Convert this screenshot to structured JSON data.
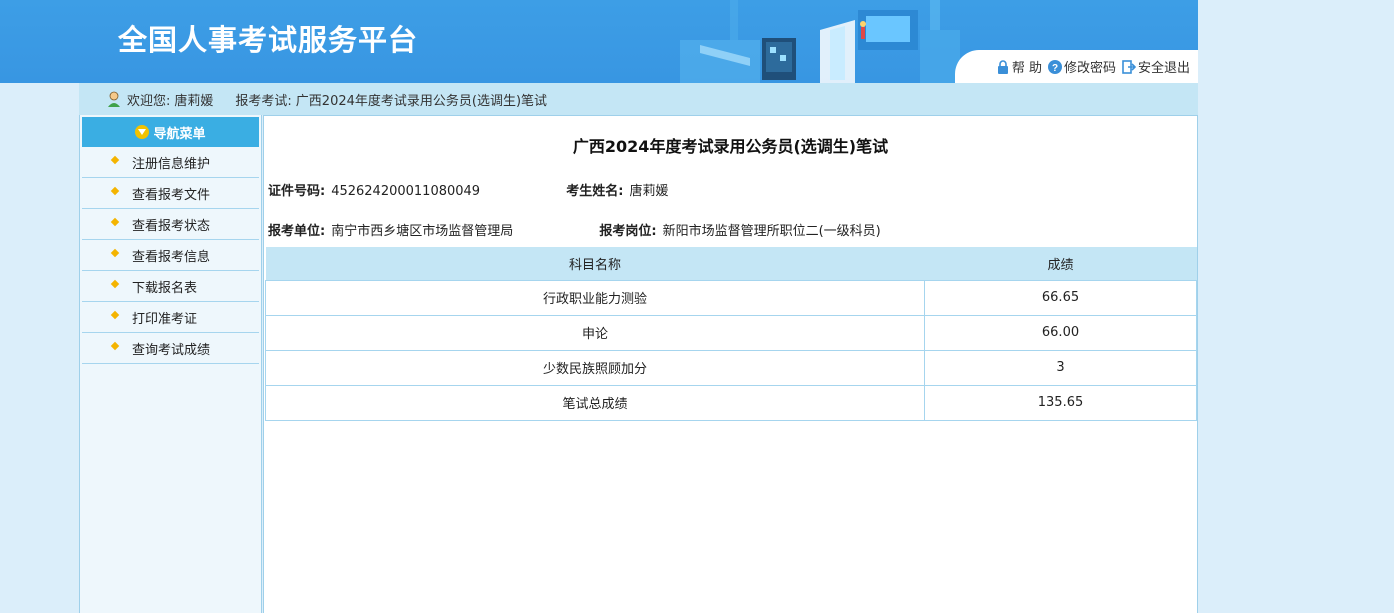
{
  "header": {
    "title": "全国人事考试服务平台",
    "links": [
      {
        "label": "帮 助",
        "icon": "lock-icon"
      },
      {
        "label": "修改密码",
        "icon": "help-icon"
      },
      {
        "label": "安全退出",
        "icon": "logout-icon"
      }
    ]
  },
  "welcome": {
    "greeting": "欢迎您:",
    "user_name": "唐莉媛",
    "exam_label": "报考考试:",
    "exam_name": "广西2024年度考试录用公务员(选调生)笔试"
  },
  "sidebar": {
    "title": "导航菜单",
    "items": [
      {
        "label": "注册信息维护"
      },
      {
        "label": "查看报考文件"
      },
      {
        "label": "查看报考状态"
      },
      {
        "label": "查看报考信息"
      },
      {
        "label": "下载报名表"
      },
      {
        "label": "打印准考证"
      },
      {
        "label": "查询考试成绩"
      }
    ]
  },
  "main": {
    "title": "广西2024年度考试录用公务员(选调生)笔试",
    "id_label": "证件号码:",
    "id_value": "452624200011080049",
    "name_label": "考生姓名:",
    "name_value": "唐莉媛",
    "unit_label": "报考单位:",
    "unit_value": "南宁市西乡塘区市场监督管理局",
    "post_label": "报考岗位:",
    "post_value": "新阳市场监督管理所职位二(一级科员)",
    "table": {
      "headers": [
        "科目名称",
        "成绩"
      ],
      "rows": [
        [
          "行政职业能力测验",
          "66.65"
        ],
        [
          "申论",
          "66.00"
        ],
        [
          "少数民族照顾加分",
          "3"
        ],
        [
          "笔试总成绩",
          "135.65"
        ]
      ]
    }
  },
  "colors": {
    "header_blue": "#3896e2",
    "nav_header": "#3aaee3",
    "bar_light_blue": "#c4e6f5",
    "bullet_gold": "#f4b400"
  }
}
